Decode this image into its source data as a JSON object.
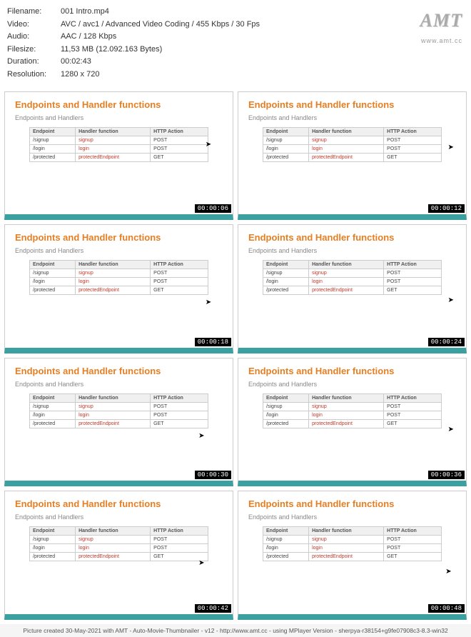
{
  "header": {
    "filename": {
      "label": "Filename:",
      "value": "001 Intro.mp4"
    },
    "video": {
      "label": "Video:",
      "value": "AVC / avc1 / Advanced Video Coding / 455 Kbps / 30 Fps"
    },
    "audio": {
      "label": "Audio:",
      "value": "AAC / 128 Kbps"
    },
    "filesize": {
      "label": "Filesize:",
      "value": "11,53 MB (12.092.163 Bytes)"
    },
    "duration": {
      "label": "Duration:",
      "value": "00:02:43"
    },
    "resolution": {
      "label": "Resolution:",
      "value": "1280 x 720"
    }
  },
  "watermark": {
    "title": "AMT",
    "url": "www.amt.cc"
  },
  "slide": {
    "title": "Endpoints and Handler functions",
    "subtitle": "Endpoints and Handlers",
    "columns": [
      "Endpoint",
      "Handler function",
      "HTTP Action"
    ],
    "rows": [
      [
        "/signup",
        "signup",
        "POST"
      ],
      [
        "/login",
        "login",
        "POST"
      ],
      [
        "/protected",
        "protectedEndpoint",
        "GET"
      ]
    ]
  },
  "thumbs": [
    {
      "timestamp": "00:00:06",
      "cursor_top": "40%",
      "cursor_left": "88%"
    },
    {
      "timestamp": "00:00:12",
      "cursor_top": "42%",
      "cursor_left": "92%"
    },
    {
      "timestamp": "00:00:18",
      "cursor_top": "60%",
      "cursor_left": "88%"
    },
    {
      "timestamp": "00:00:24",
      "cursor_top": "58%",
      "cursor_left": "92%"
    },
    {
      "timestamp": "00:00:30",
      "cursor_top": "60%",
      "cursor_left": "85%"
    },
    {
      "timestamp": "00:00:36",
      "cursor_top": "55%",
      "cursor_left": "92%"
    },
    {
      "timestamp": "00:00:42",
      "cursor_top": "55%",
      "cursor_left": "85%"
    },
    {
      "timestamp": "00:00:48",
      "cursor_top": "62%",
      "cursor_left": "91%"
    }
  ],
  "footer": "Picture created 30-May-2021 with AMT - Auto-Movie-Thumbnailer - v12 - http://www.amt.cc - using MPlayer Version - sherpya-r38154+g9fe07908c3-8.3-win32"
}
